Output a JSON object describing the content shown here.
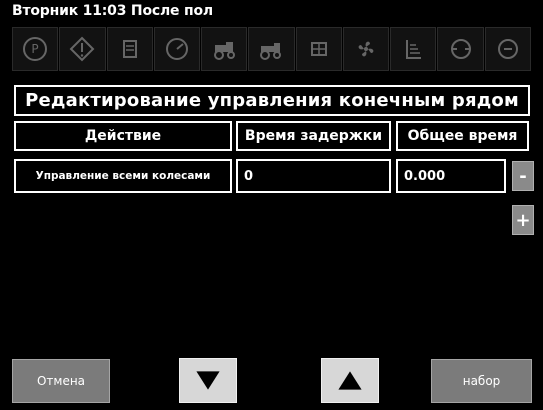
{
  "status_bar": {
    "text": "Вторник 11:03 После пол"
  },
  "icons": [
    "parking-brake-icon",
    "warning-icon",
    "engine-coolant-icon",
    "gauge-icon",
    "tractor-icon-1",
    "tractor-icon-2",
    "hydraulic-icon",
    "fan-icon",
    "lift-icon",
    "filter-icon-1",
    "filter-icon-2"
  ],
  "page": {
    "title": "Редактирование управления конечным рядом"
  },
  "table": {
    "headers": [
      "Действие",
      "Время задержки",
      "Общее время"
    ],
    "rows": [
      {
        "action": "Управление всеми колесами",
        "delay": "0",
        "total": "0.000"
      }
    ]
  },
  "controls": {
    "minus": "-",
    "plus": "+"
  },
  "bottom": {
    "cancel": "Отмена",
    "set": "набор"
  }
}
